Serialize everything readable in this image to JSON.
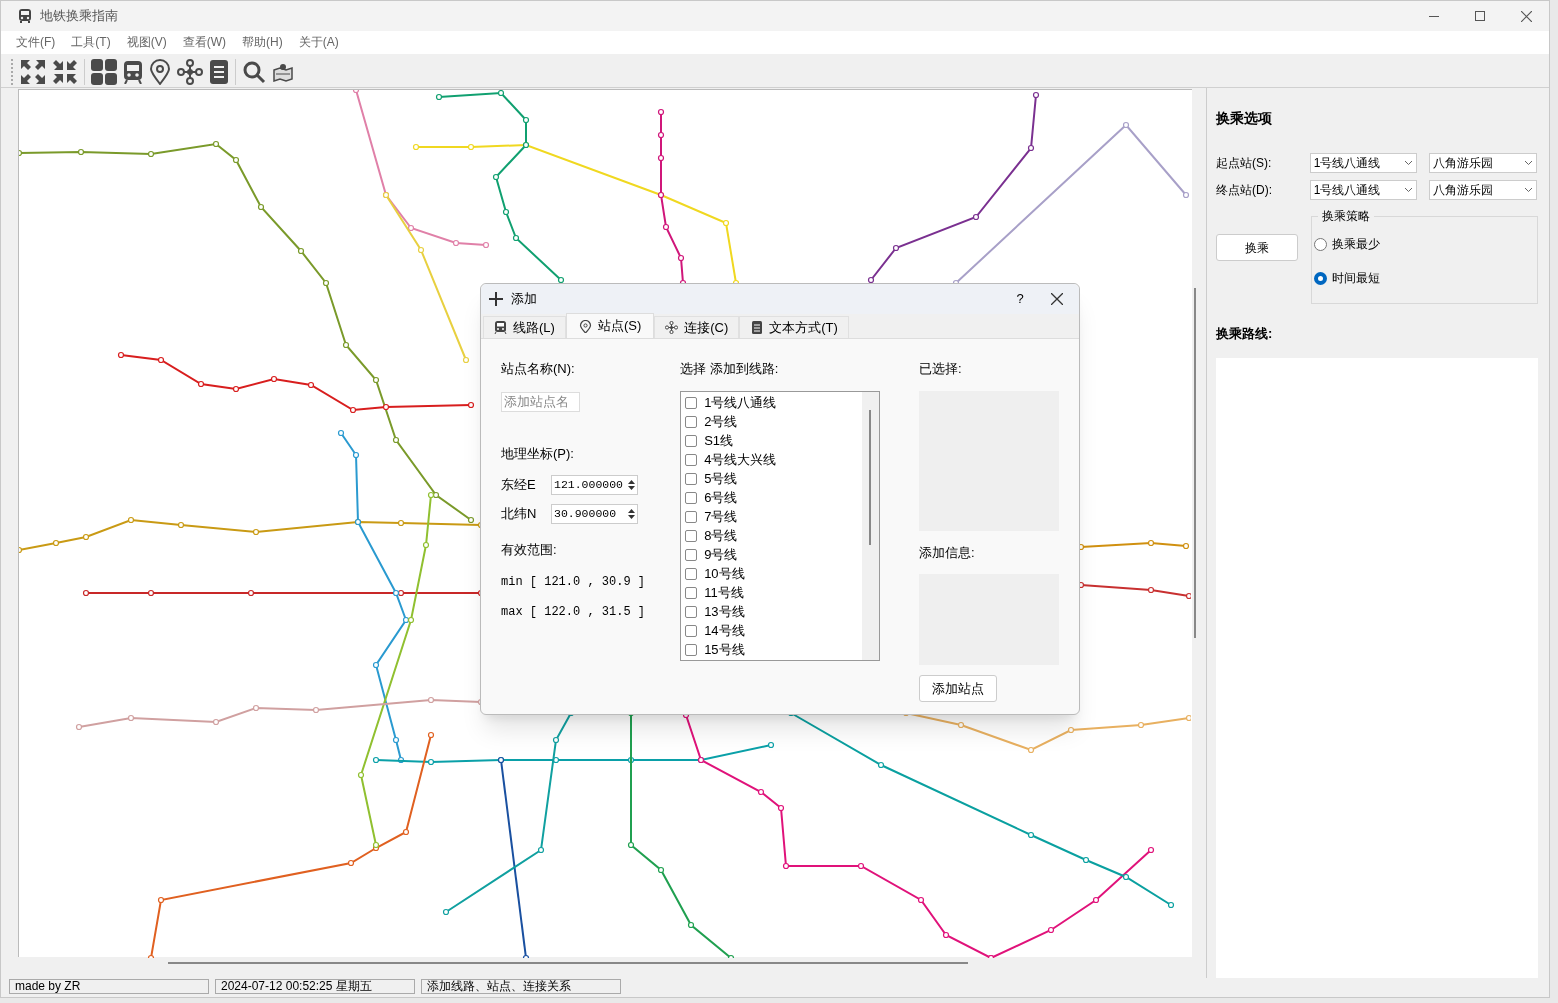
{
  "window": {
    "title": "地铁换乘指南"
  },
  "menu": [
    "文件(F)",
    "工具(T)",
    "视图(V)",
    "查看(W)",
    "帮助(H)",
    "关于(A)"
  ],
  "dialog": {
    "title": "添加",
    "help": "?",
    "tabs": [
      {
        "label": "线路(L)",
        "selected": false
      },
      {
        "label": "站点(S)",
        "selected": true
      },
      {
        "label": "连接(C)",
        "selected": false
      },
      {
        "label": "文本方式(T)",
        "selected": false
      }
    ],
    "name_label": "站点名称(N):",
    "name_field": {
      "placeholder": "添加站点名"
    },
    "coord_label": "地理坐标(P):",
    "longitude": {
      "label": "东经E",
      "value": "121.000000"
    },
    "latitude": {
      "label": "北纬N",
      "value": "30.900000"
    },
    "range_label": "有效范围:",
    "range_min": "min [ 121.0 , 30.9 ]",
    "range_max": "max [ 122.0 , 31.5 ]",
    "list_label": "选择 添加到线路:",
    "lines": [
      {
        "label": "1号线八通线",
        "checked": false
      },
      {
        "label": "2号线",
        "checked": false
      },
      {
        "label": "S1线",
        "checked": false
      },
      {
        "label": "4号线大兴线",
        "checked": false
      },
      {
        "label": "5号线",
        "checked": false
      },
      {
        "label": "6号线",
        "checked": false
      },
      {
        "label": "7号线",
        "checked": false
      },
      {
        "label": "8号线",
        "checked": false
      },
      {
        "label": "9号线",
        "checked": false
      },
      {
        "label": "10号线",
        "checked": false
      },
      {
        "label": "11号线",
        "checked": false
      },
      {
        "label": "13号线",
        "checked": false
      },
      {
        "label": "14号线",
        "checked": false
      },
      {
        "label": "15号线",
        "checked": false
      }
    ],
    "selected_label": "已选择:",
    "info_label": "添加信息:",
    "add_button": "添加站点"
  },
  "panel": {
    "title": "换乘选项",
    "start": {
      "label": "起点站(S):",
      "line": "1号线八通线",
      "station": "八角游乐园"
    },
    "end": {
      "label": "终点站(D):",
      "line": "1号线八通线",
      "station": "八角游乐园"
    },
    "strategy": {
      "title": "换乘策略",
      "options": [
        {
          "label": "换乘最少",
          "selected": false
        },
        {
          "label": "时间最短",
          "selected": true
        }
      ]
    },
    "button": "换乘",
    "route_label": "换乘路线:"
  },
  "status_bar": [
    "made by ZR",
    "2024-07-12 00:52:25 星期五",
    "添加线路、站点、连接关系"
  ]
}
